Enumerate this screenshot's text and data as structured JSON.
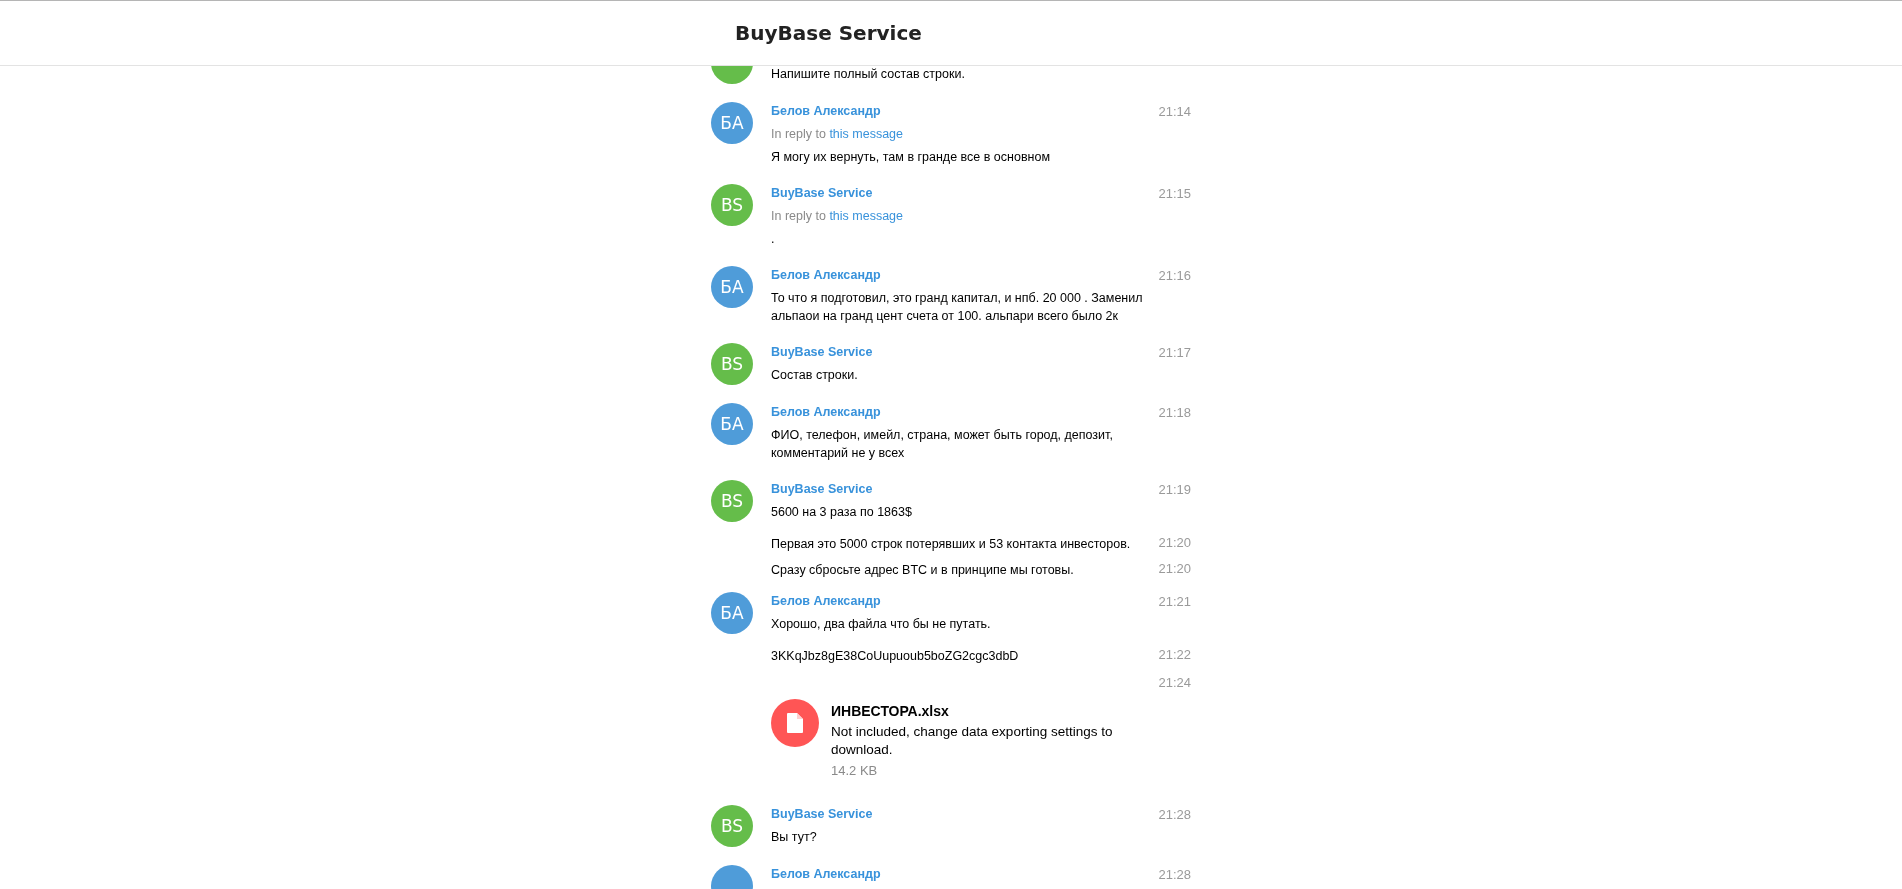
{
  "header": {
    "title": "BuyBase Service"
  },
  "messages": [
    {
      "avatar": {
        "color": "#65bd4a"
      },
      "text": "Напишите полный состав строки."
    },
    {
      "avatar": {
        "initials": "БА",
        "color": "#4f9cd9"
      },
      "from": "Белов Александр",
      "time": "21:14",
      "reply": {
        "prefix": "In reply to",
        "link": "this message"
      },
      "text": "Я могу их вернуть, там в гранде все в основном"
    },
    {
      "avatar": {
        "initials": "BS",
        "color": "#65bd4a"
      },
      "from": "BuyBase Service",
      "time": "21:15",
      "reply": {
        "prefix": "In reply to",
        "link": "this message"
      },
      "text": "."
    },
    {
      "avatar": {
        "initials": "БА",
        "color": "#4f9cd9"
      },
      "from": "Белов Александр",
      "time": "21:16",
      "text": "То что я подготовил, это гранд капитал, и нпб. 20 000 . Заменил альпаои на гранд цент счета от 100. альпари всего было 2к"
    },
    {
      "avatar": {
        "initials": "BS",
        "color": "#65bd4a"
      },
      "from": "BuyBase Service",
      "time": "21:17",
      "text": "Состав строки."
    },
    {
      "avatar": {
        "initials": "БА",
        "color": "#4f9cd9"
      },
      "from": "Белов Александр",
      "time": "21:18",
      "text": "ФИО, телефон, имейл, страна, может быть город, депозит, комментарий не у всех"
    },
    {
      "avatar": {
        "initials": "BS",
        "color": "#65bd4a"
      },
      "from": "BuyBase Service",
      "time": "21:19",
      "text": "5600 на 3 раза по 1863$"
    },
    {
      "time": "21:20",
      "text": "Первая это 5000 строк потерявших и 53 контакта инвесторов."
    },
    {
      "time": "21:20",
      "text": "Сразу сбросьте адрес BTC и в принципе мы готовы."
    },
    {
      "avatar": {
        "initials": "БА",
        "color": "#4f9cd9"
      },
      "from": "Белов Александр",
      "time": "21:21",
      "text": "Хорошо, два файла что бы не путать."
    },
    {
      "time": "21:22",
      "text": "3KKqJbz8gE38CoUupuoub5boZG2cgc3dbD"
    },
    {
      "time": "21:24",
      "file": {
        "name": "ИНВЕСТОРА.xlsx",
        "description": "Not included, change data exporting settings to download.",
        "size": "14.2 KB"
      }
    },
    {
      "avatar": {
        "initials": "BS",
        "color": "#65bd4a"
      },
      "from": "BuyBase Service",
      "time": "21:28",
      "text": "Вы тут?"
    },
    {
      "avatar": {
        "color": "#4f9cd9"
      },
      "from": "Белов Александр",
      "time": "21:28"
    }
  ]
}
